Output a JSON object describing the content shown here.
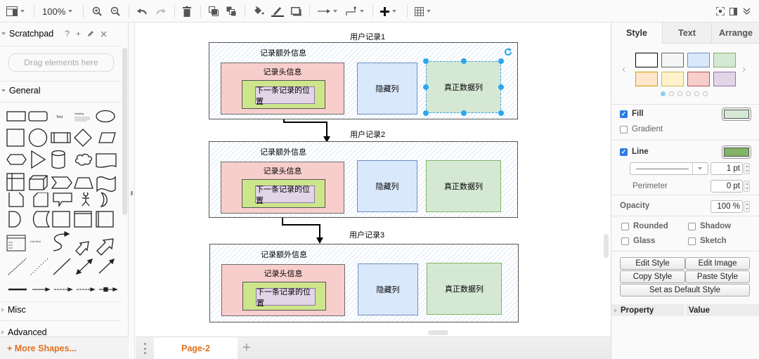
{
  "toolbar": {
    "zoom": "100%",
    "items": [
      {
        "name": "format-panel-toggle",
        "icon": "panel-layout-icon"
      },
      {
        "name": "zoom-dropdown",
        "icon": "none"
      },
      {
        "name": "zoom-in",
        "icon": "zoom-in-icon"
      },
      {
        "name": "zoom-out",
        "icon": "zoom-out-icon"
      },
      {
        "name": "undo",
        "icon": "undo-icon"
      },
      {
        "name": "redo",
        "icon": "redo-icon"
      },
      {
        "name": "delete",
        "icon": "trash-icon"
      },
      {
        "name": "to-front",
        "icon": "to-front-icon"
      },
      {
        "name": "to-back",
        "icon": "to-back-icon"
      },
      {
        "name": "fill-color",
        "icon": "paint-bucket-icon"
      },
      {
        "name": "line-color",
        "icon": "pencil-icon"
      },
      {
        "name": "shadow",
        "icon": "shadow-icon"
      },
      {
        "name": "connection",
        "icon": "arrow-right-icon"
      },
      {
        "name": "waypoints",
        "icon": "waypoint-icon"
      },
      {
        "name": "insert",
        "icon": "plus-icon"
      },
      {
        "name": "table",
        "icon": "table-icon"
      },
      {
        "name": "fullscreen",
        "icon": "fullscreen-icon"
      },
      {
        "name": "toggle-sidebar",
        "icon": "sidebar-icon"
      },
      {
        "name": "collapse",
        "icon": "double-chevron-icon"
      }
    ]
  },
  "sidebar": {
    "scratchpad": {
      "title": "Scratchpad",
      "help": "?",
      "add": "+",
      "drop_hint": "Drag elements here"
    },
    "sections": [
      {
        "title": "General",
        "expanded": true
      },
      {
        "title": "Misc",
        "expanded": false
      },
      {
        "title": "Advanced",
        "expanded": false
      }
    ],
    "shape_labels": {
      "text": "Text",
      "heading": "Heading",
      "list_item": "List Item"
    },
    "more_shapes": "+ More Shapes..."
  },
  "pages": {
    "tabs": [
      {
        "label": "Page-2",
        "active": true
      }
    ],
    "add": "+"
  },
  "diagram": {
    "records": [
      {
        "title": "用户记录1",
        "extra": "记录额外信息",
        "header": "记录头信息",
        "next": "下一条记录的位置",
        "hidden": "隐藏列",
        "data": "真正数据列",
        "selected": true
      },
      {
        "title": "用户记录2",
        "extra": "记录额外信息",
        "header": "记录头信息",
        "next": "下一条记录的位置",
        "hidden": "隐藏列",
        "data": "真正数据列",
        "selected": false
      },
      {
        "title": "用户记录3",
        "extra": "记录额外信息",
        "header": "记录头信息",
        "next": "下一条记录的位置",
        "hidden": "隐藏列",
        "data": "真正数据列",
        "selected": false
      }
    ]
  },
  "format": {
    "tabs": [
      {
        "label": "Style",
        "active": true
      },
      {
        "label": "Text",
        "active": false
      },
      {
        "label": "Arrange",
        "active": false
      }
    ],
    "swatches": [
      {
        "fill": "#ffffff",
        "stroke": "#000000"
      },
      {
        "fill": "#f5f5f5",
        "stroke": "#666666"
      },
      {
        "fill": "#dae8fc",
        "stroke": "#6c8ebf"
      },
      {
        "fill": "#d5e8d4",
        "stroke": "#82b366"
      },
      {
        "fill": "#ffe6cc",
        "stroke": "#d79b00"
      },
      {
        "fill": "#fff2cc",
        "stroke": "#d6b656"
      },
      {
        "fill": "#f8cecc",
        "stroke": "#b85450"
      },
      {
        "fill": "#e1d5e7",
        "stroke": "#9673a6"
      }
    ],
    "swatch_pages": 6,
    "swatch_page_active": 1,
    "fill": {
      "label": "Fill",
      "checked": true,
      "color": "#d5e8d4"
    },
    "gradient": {
      "label": "Gradient",
      "checked": false
    },
    "line": {
      "label": "Line",
      "checked": true,
      "color": "#82b366",
      "width": "1 pt"
    },
    "perimeter": {
      "label": "Perimeter",
      "value": "0 pt"
    },
    "opacity": {
      "label": "Opacity",
      "value": "100 %"
    },
    "options": [
      {
        "label": "Rounded",
        "checked": false
      },
      {
        "label": "Shadow",
        "checked": false
      },
      {
        "label": "Glass",
        "checked": false
      },
      {
        "label": "Sketch",
        "checked": false
      }
    ],
    "buttons": {
      "edit_style": "Edit Style",
      "edit_image": "Edit Image",
      "copy_style": "Copy Style",
      "paste_style": "Paste Style",
      "set_default": "Set as Default Style"
    },
    "properties": {
      "col1": "Property",
      "col2": "Value"
    }
  }
}
